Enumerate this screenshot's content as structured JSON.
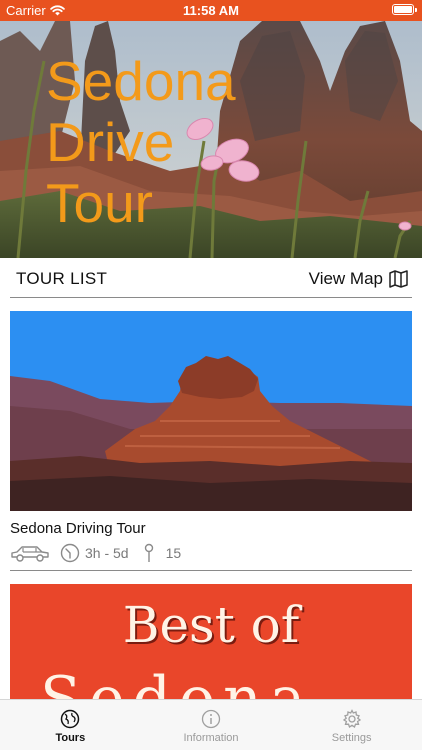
{
  "status_bar": {
    "carrier": "Carrier",
    "time": "11:58 AM",
    "wifi_icon": "wifi-icon",
    "battery_icon": "battery-icon"
  },
  "hero": {
    "title_lines": [
      "Sedona",
      "Drive",
      "Tour"
    ],
    "title_color": "#f39a1a"
  },
  "tour_list_header": {
    "title": "TOUR LIST",
    "view_map_label": "View Map",
    "map_icon": "map-icon"
  },
  "tours": [
    {
      "name": "Sedona Driving Tour",
      "vehicle_icon": "car-icon",
      "duration_icon": "clock-icon",
      "duration": "3h - 5d",
      "stops_icon": "pin-icon",
      "stops": "15"
    },
    {
      "image_text_line1": "Best of",
      "image_text_line2": "Sedona"
    }
  ],
  "tab_bar": {
    "tabs": [
      {
        "label": "Tours",
        "icon": "globe-icon",
        "active": true
      },
      {
        "label": "Information",
        "icon": "info-icon",
        "active": false
      },
      {
        "label": "Settings",
        "icon": "gear-icon",
        "active": false
      }
    ]
  },
  "colors": {
    "status_bar_bg": "#e8521f",
    "accent_orange": "#f39a1a",
    "active_tab": "#111111",
    "inactive_tab": "#9a9a9a"
  }
}
